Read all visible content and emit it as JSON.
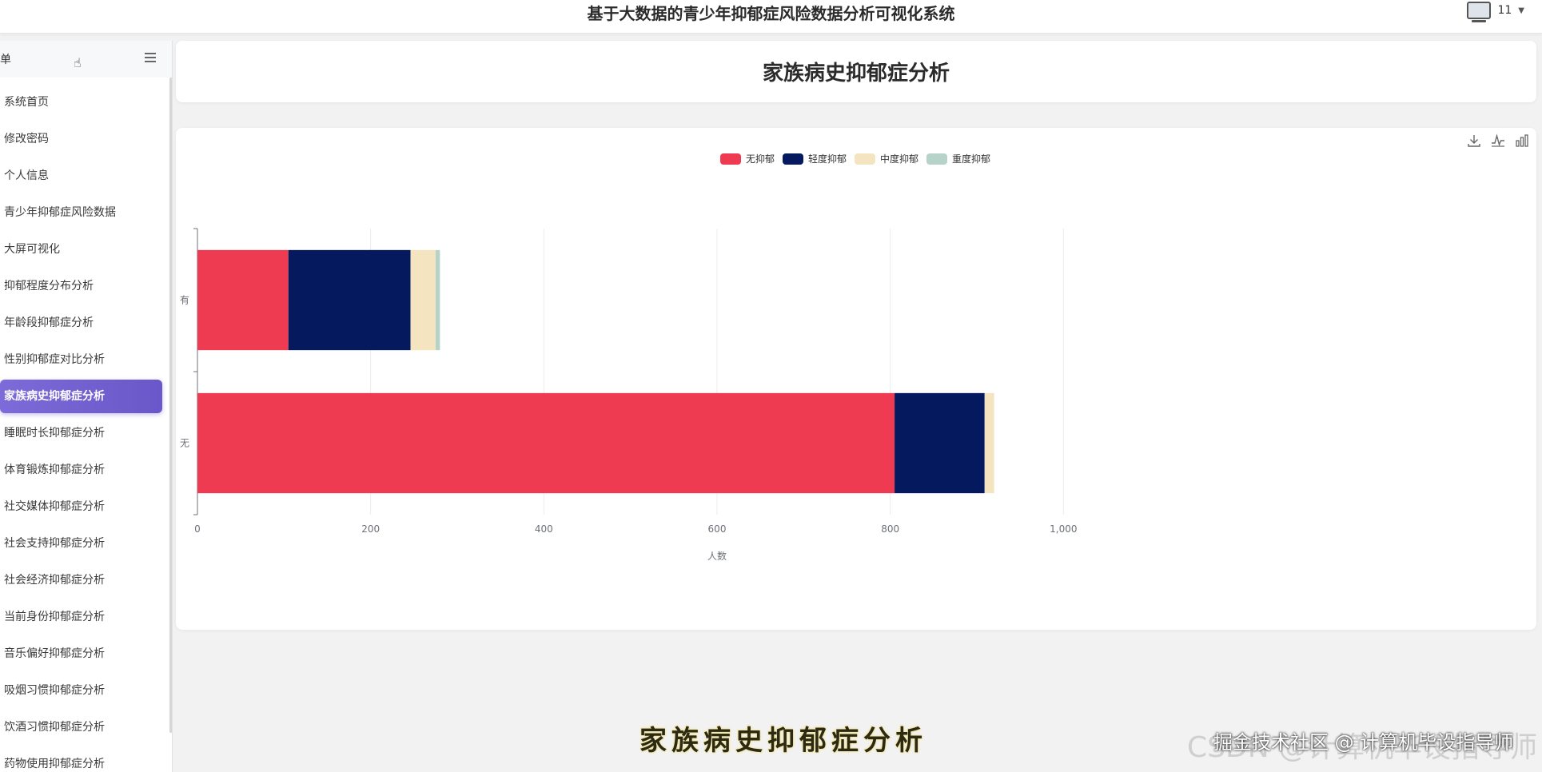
{
  "app": {
    "title": "基于大数据的青少年抑郁症风险数据分析可视化系统",
    "user_name": "11"
  },
  "sidebar": {
    "header_label": "单",
    "items": [
      {
        "label": "系统首页",
        "active": false
      },
      {
        "label": "修改密码",
        "active": false
      },
      {
        "label": "个人信息",
        "active": false
      },
      {
        "label": "青少年抑郁症风险数据",
        "active": false
      },
      {
        "label": "大屏可视化",
        "active": false
      },
      {
        "label": "抑郁程度分布分析",
        "active": false
      },
      {
        "label": "年龄段抑郁症分析",
        "active": false
      },
      {
        "label": "性别抑郁症对比分析",
        "active": false
      },
      {
        "label": "家族病史抑郁症分析",
        "active": true
      },
      {
        "label": "睡眠时长抑郁症分析",
        "active": false
      },
      {
        "label": "体育锻炼抑郁症分析",
        "active": false
      },
      {
        "label": "社交媒体抑郁症分析",
        "active": false
      },
      {
        "label": "社会支持抑郁症分析",
        "active": false
      },
      {
        "label": "社会经济抑郁症分析",
        "active": false
      },
      {
        "label": "当前身份抑郁症分析",
        "active": false
      },
      {
        "label": "音乐偏好抑郁症分析",
        "active": false
      },
      {
        "label": "吸烟习惯抑郁症分析",
        "active": false
      },
      {
        "label": "饮酒习惯抑郁症分析",
        "active": false
      },
      {
        "label": "药物使用抑郁症分析",
        "active": false
      }
    ]
  },
  "page": {
    "title": "家族病史抑郁症分析"
  },
  "toolbox": {
    "icons": [
      "download-icon",
      "line-chart-icon",
      "bar-chart-icon"
    ]
  },
  "chart_data": {
    "type": "bar",
    "orientation": "horizontal",
    "stacked": true,
    "categories": [
      "有",
      "无"
    ],
    "series": [
      {
        "name": "无抑郁",
        "color": "#ee3b52",
        "values": [
          105,
          805
        ]
      },
      {
        "name": "轻度抑郁",
        "color": "#051a5e",
        "values": [
          141,
          104
        ]
      },
      {
        "name": "中度抑郁",
        "color": "#f4e5c0",
        "values": [
          29,
          11
        ]
      },
      {
        "name": "重度抑郁",
        "color": "#b6d3c9",
        "values": [
          5,
          0
        ]
      }
    ],
    "xlabel": "人数",
    "ylabel": "",
    "xlim": [
      0,
      1200
    ],
    "xticks": [
      0,
      200,
      400,
      600,
      800,
      1000
    ],
    "xtick_labels": [
      "0",
      "200",
      "400",
      "600",
      "800",
      "1,000"
    ],
    "grid": true,
    "legend_position": "top-center"
  },
  "overlay": {
    "caption": "家族病史抑郁症分析",
    "watermark": "掘金技术社区 @ 计算机毕设指导师",
    "watermark_faded": "CSDN @计算机毕设指导师"
  }
}
